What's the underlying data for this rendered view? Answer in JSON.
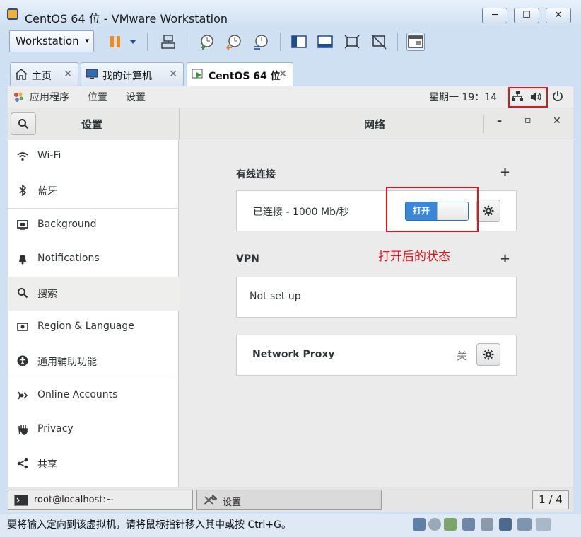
{
  "window": {
    "title": "CentOS 64 位 - VMware Workstation",
    "minimize": "─",
    "maximize": "☐",
    "close": "✕"
  },
  "toolbar": {
    "menu_label": "Workstation",
    "caret": "▾"
  },
  "tabs": [
    {
      "label": "主页",
      "icon": "home-icon"
    },
    {
      "label": "我的计算机",
      "icon": "computer-icon"
    },
    {
      "label": "CentOS 64 位",
      "icon": "vm-icon"
    }
  ],
  "tab_close": "✕",
  "gnome_topbar": {
    "applications": "应用程序",
    "places": "位置",
    "settings": "设置",
    "clock": "星期一 19：14"
  },
  "headerbar": {
    "left_title": "设置",
    "main_title": "网络",
    "minimize": "–",
    "maximize": "▫",
    "close": "✕"
  },
  "sidebar": {
    "items": [
      {
        "label": "Wi-Fi",
        "icon": "wifi-icon"
      },
      {
        "label": "蓝牙",
        "icon": "bluetooth-icon"
      },
      {
        "label": "Background",
        "icon": "background-icon"
      },
      {
        "label": "Notifications",
        "icon": "bell-icon"
      },
      {
        "label": "搜索",
        "icon": "search-icon"
      },
      {
        "label": "Region & Language",
        "icon": "region-icon"
      },
      {
        "label": "通用辅助功能",
        "icon": "accessibility-icon"
      },
      {
        "label": "Online Accounts",
        "icon": "online-accounts-icon"
      },
      {
        "label": "Privacy",
        "icon": "hand-icon"
      },
      {
        "label": "共享",
        "icon": "share-icon"
      }
    ],
    "selected_index": 4
  },
  "network": {
    "wired_title": "有线连接",
    "plus": "+",
    "wired_status": "已连接 - 1000 Mb/秒",
    "switch_label": "打开",
    "switch_on": true,
    "vpn_title": "VPN",
    "vpn_status": "Not set up",
    "proxy_label": "Network Proxy",
    "proxy_state": "关",
    "annotation": "打开后的状态"
  },
  "taskbar": {
    "terminal": "root@localhost:~",
    "settings": "设置",
    "pager": "1 / 4"
  },
  "status": {
    "message": "要将输入定向到该虚拟机，请将鼠标指针移入其中或按 Ctrl+G。"
  },
  "colors": {
    "accent": "#3b86d6",
    "highlight_box": "#e0161c"
  }
}
